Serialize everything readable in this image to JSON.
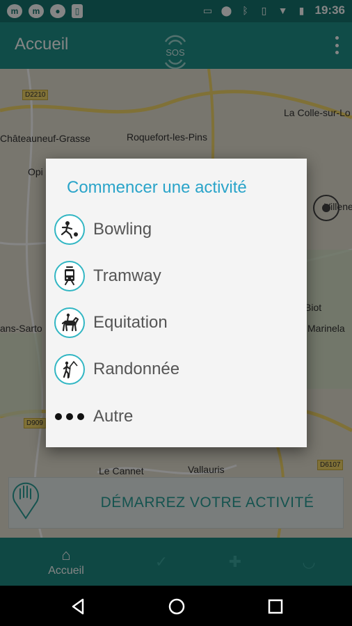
{
  "status_bar": {
    "left_icons": [
      "messenger-icon",
      "m-app-icon",
      "circle-app-icon",
      "phone-app-icon"
    ],
    "right_icons": [
      "cast-icon",
      "location-icon",
      "bluetooth-icon",
      "vibrate-icon",
      "wifi-icon",
      "battery-icon"
    ],
    "time": "19:36"
  },
  "app_bar": {
    "title": "Accueil",
    "logo_text": "SOS",
    "accent_color": "#20938b"
  },
  "map": {
    "places": [
      "La Colle-sur-Lo",
      "Châteauneuf-Grasse",
      "Roquefort-les-Pins",
      "Opi",
      "Villene",
      "Biot",
      "Marinela",
      "ans-Sarto",
      "Le Cannet",
      "Vallauris",
      "Marinela"
    ],
    "road_tags": [
      "D2210",
      "D909",
      "D6107"
    ]
  },
  "start_activity": {
    "label": "DÉMARREZ VOTRE ACTIVITÉ"
  },
  "bottom_nav": {
    "home_label": "Accueil"
  },
  "dialog": {
    "title": "Commencer une activité",
    "options": [
      {
        "label": "Bowling",
        "icon": "bowling-icon"
      },
      {
        "label": "Tramway",
        "icon": "tramway-icon"
      },
      {
        "label": "Equitation",
        "icon": "horse-riding-icon"
      },
      {
        "label": "Randonnée",
        "icon": "hiking-icon"
      },
      {
        "label": "Autre",
        "icon": "more-dots-icon"
      }
    ],
    "title_color": "#2aa4c9"
  }
}
